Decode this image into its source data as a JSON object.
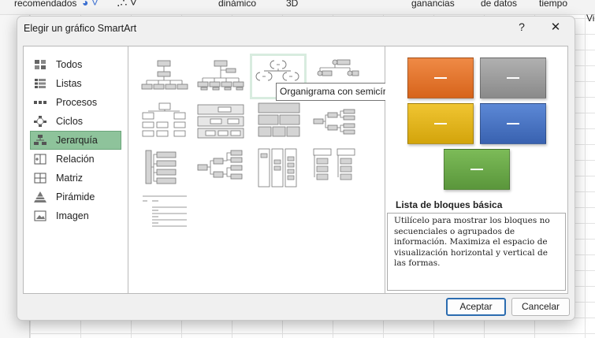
{
  "background": {
    "ribbon_items": [
      "recomendados",
      "dinámico",
      "3D",
      "ganancias",
      "de datos",
      "tiempo"
    ],
    "right_label": "Vi"
  },
  "dialog": {
    "title": "Elegir un gráfico SmartArt",
    "help_label": "?",
    "close_label": "✕",
    "categories": [
      {
        "label": "Todos",
        "icon": "all-icon"
      },
      {
        "label": "Listas",
        "icon": "list-icon"
      },
      {
        "label": "Procesos",
        "icon": "process-icon"
      },
      {
        "label": "Ciclos",
        "icon": "cycle-icon"
      },
      {
        "label": "Jerarquía",
        "icon": "hierarchy-icon",
        "selected": true
      },
      {
        "label": "Relación",
        "icon": "relationship-icon"
      },
      {
        "label": "Matriz",
        "icon": "matrix-icon"
      },
      {
        "label": "Pirámide",
        "icon": "pyramid-icon"
      },
      {
        "label": "Imagen",
        "icon": "picture-icon"
      }
    ],
    "tooltip": "Organigrama con semicírculos",
    "preview": {
      "colors": [
        "#e2722a",
        "#9a9a9a",
        "#e0b213",
        "#4a74c0",
        "#6aa646"
      ],
      "title": "Lista de bloques básica",
      "description": "Utilícelo para mostrar los bloques no secuenciales o agrupados de información. Maximiza el espacio de visualización horizontal y vertical de las formas."
    },
    "ok_label": "Aceptar",
    "cancel_label": "Cancelar"
  }
}
